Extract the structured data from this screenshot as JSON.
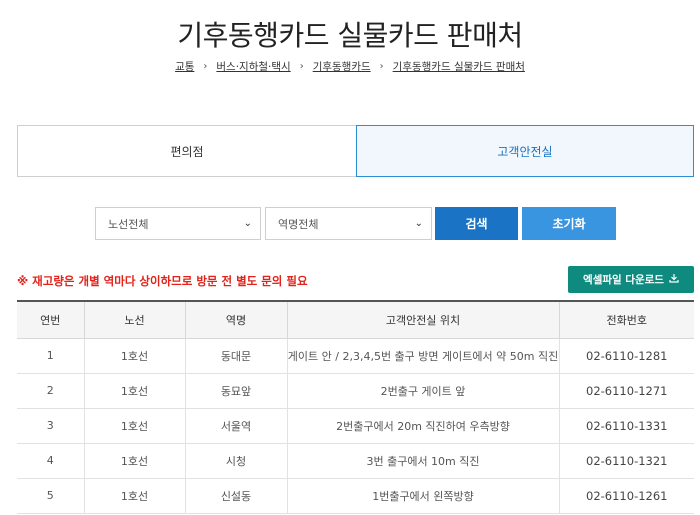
{
  "page": {
    "title": "기후동행카드 실물카드 판매처"
  },
  "breadcrumb": {
    "items": [
      "교통",
      "버스·지하철·택시",
      "기후동행카드",
      "기후동행카드 실물카드 판매처"
    ],
    "separator": "›"
  },
  "tabs": [
    {
      "label": "편의점",
      "active": false
    },
    {
      "label": "고객안전실",
      "active": true
    }
  ],
  "filters": {
    "line_select": "노선전체",
    "station_select": "역명전체",
    "search_label": "검색",
    "reset_label": "초기화"
  },
  "notice": "※ 재고량은 개별 역마다 상이하므로 방문 전 별도 문의 필요",
  "excel_button": {
    "label": "엑셀파일 다운로드",
    "icon": "download-icon"
  },
  "table": {
    "headers": [
      "연번",
      "노선",
      "역명",
      "고객안전실 위치",
      "전화번호"
    ],
    "rows": [
      [
        "1",
        "1호선",
        "동대문",
        "게이트 안 / 2,3,4,5번 출구 방면 게이트에서 약 50m 직진",
        "02-6110-1281"
      ],
      [
        "2",
        "1호선",
        "동묘앞",
        "2번출구 게이트 앞",
        "02-6110-1271"
      ],
      [
        "3",
        "1호선",
        "서울역",
        "2번출구에서 20m 직진하여 우측방향",
        "02-6110-1331"
      ],
      [
        "4",
        "1호선",
        "시청",
        "3번 출구에서 10m 직진",
        "02-6110-1321"
      ],
      [
        "5",
        "1호선",
        "신설동",
        "1번출구에서 왼쪽방향",
        "02-6110-1261"
      ]
    ]
  },
  "colors": {
    "primary": "#1a73c4",
    "secondary": "#3a95e0",
    "excel": "#0f8a7e",
    "notice": "#e2231a"
  }
}
